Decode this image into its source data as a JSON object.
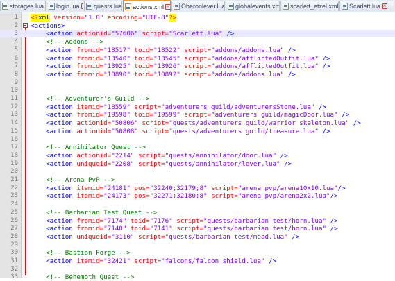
{
  "tabs": [
    {
      "label": "storages.lua",
      "active": false
    },
    {
      "label": "login.lua",
      "active": false
    },
    {
      "label": "quests.lua",
      "active": false
    },
    {
      "label": "actions.xml",
      "active": true
    },
    {
      "label": "Oberonlever.lua",
      "active": false
    },
    {
      "label": "globalevents.xml",
      "active": false
    },
    {
      "label": "scarlett_etzel.xml",
      "active": false
    },
    {
      "label": "Scarlett.lua",
      "active": false
    }
  ],
  "colors": {
    "tag": "#0000ff",
    "attribute": "#ff0000",
    "value": "#8000ff",
    "comment": "#008000",
    "xml_decl_highlight": "#ffff00",
    "current_line": "#e8e8ff",
    "active_tab_accent": "#f39b25"
  },
  "editor": {
    "current_line": 3,
    "lines": [
      {
        "n": "1",
        "tokens": [
          {
            "t": "<?",
            "c": "declq"
          },
          {
            "t": "xml",
            "c": "decl"
          },
          {
            "t": " version=",
            "c": "attr"
          },
          {
            "t": "\"1.0\"",
            "c": "val"
          },
          {
            "t": " encoding=",
            "c": "attr"
          },
          {
            "t": "\"UTF-8\"",
            "c": "val"
          },
          {
            "t": "?>",
            "c": "declq"
          }
        ]
      },
      {
        "n": "2",
        "tokens": [
          {
            "t": "<actions>",
            "c": "tag"
          }
        ]
      },
      {
        "n": "3",
        "tokens": [
          {
            "t": "    "
          },
          {
            "t": "<action",
            "c": "tag"
          },
          {
            "t": " actionid=",
            "c": "attr"
          },
          {
            "t": "\"57606\"",
            "c": "val"
          },
          {
            "t": " script=",
            "c": "attr"
          },
          {
            "t": "\"Scarlett.lua\"",
            "c": "val"
          },
          {
            "t": " />",
            "c": "tag"
          }
        ]
      },
      {
        "n": "4",
        "tokens": [
          {
            "t": "    "
          },
          {
            "t": "<!-- Addons -->",
            "c": "comment"
          }
        ]
      },
      {
        "n": "5",
        "tokens": [
          {
            "t": "    "
          },
          {
            "t": "<action",
            "c": "tag"
          },
          {
            "t": " fromid=",
            "c": "attr"
          },
          {
            "t": "\"18517\"",
            "c": "val"
          },
          {
            "t": " toid=",
            "c": "attr"
          },
          {
            "t": "\"18522\"",
            "c": "val"
          },
          {
            "t": " script=",
            "c": "attr"
          },
          {
            "t": "\"addons/addons.lua\"",
            "c": "val"
          },
          {
            "t": " />",
            "c": "tag"
          }
        ]
      },
      {
        "n": "6",
        "tokens": [
          {
            "t": "    "
          },
          {
            "t": "<action",
            "c": "tag"
          },
          {
            "t": " fromid=",
            "c": "attr"
          },
          {
            "t": "\"13540\"",
            "c": "val"
          },
          {
            "t": " toid=",
            "c": "attr"
          },
          {
            "t": "\"13545\"",
            "c": "val"
          },
          {
            "t": " script=",
            "c": "attr"
          },
          {
            "t": "\"addons/afflictedOutfit.lua\"",
            "c": "val"
          },
          {
            "t": " />",
            "c": "tag"
          }
        ]
      },
      {
        "n": "7",
        "tokens": [
          {
            "t": "    "
          },
          {
            "t": "<action",
            "c": "tag"
          },
          {
            "t": " fromid=",
            "c": "attr"
          },
          {
            "t": "\"13925\"",
            "c": "val"
          },
          {
            "t": " toid=",
            "c": "attr"
          },
          {
            "t": "\"13926\"",
            "c": "val"
          },
          {
            "t": " script=",
            "c": "attr"
          },
          {
            "t": "\"addons/afflictedOutfit.lua\"",
            "c": "val"
          },
          {
            "t": " />",
            "c": "tag"
          }
        ]
      },
      {
        "n": "8",
        "tokens": [
          {
            "t": "    "
          },
          {
            "t": "<action",
            "c": "tag"
          },
          {
            "t": " fromid=",
            "c": "attr"
          },
          {
            "t": "\"10890\"",
            "c": "val"
          },
          {
            "t": " toid=",
            "c": "attr"
          },
          {
            "t": "\"10892\"",
            "c": "val"
          },
          {
            "t": " script=",
            "c": "attr"
          },
          {
            "t": "\"addons/addons.lua\"",
            "c": "val"
          },
          {
            "t": " />",
            "c": "tag"
          }
        ]
      },
      {
        "n": "9",
        "tokens": []
      },
      {
        "n": "10",
        "tokens": []
      },
      {
        "n": "11",
        "tokens": [
          {
            "t": "    "
          },
          {
            "t": "<!-- Adventurer's Guild -->",
            "c": "comment"
          }
        ]
      },
      {
        "n": "12",
        "tokens": [
          {
            "t": "    "
          },
          {
            "t": "<action",
            "c": "tag"
          },
          {
            "t": " itemid=",
            "c": "attr"
          },
          {
            "t": "\"18559\"",
            "c": "val"
          },
          {
            "t": " script=",
            "c": "attr"
          },
          {
            "t": "\"adventurers guild/adventurersStone.lua\"",
            "c": "val"
          },
          {
            "t": " />",
            "c": "tag"
          }
        ]
      },
      {
        "n": "13",
        "tokens": [
          {
            "t": "    "
          },
          {
            "t": "<action",
            "c": "tag"
          },
          {
            "t": " fromid=",
            "c": "attr"
          },
          {
            "t": "\"19598\"",
            "c": "val"
          },
          {
            "t": " toid=",
            "c": "attr"
          },
          {
            "t": "\"19599\"",
            "c": "val"
          },
          {
            "t": " script=",
            "c": "attr"
          },
          {
            "t": "\"adventurers guild/magicDoor.lua\"",
            "c": "val"
          },
          {
            "t": " />",
            "c": "tag"
          }
        ]
      },
      {
        "n": "14",
        "tokens": [
          {
            "t": "    "
          },
          {
            "t": "<action",
            "c": "tag"
          },
          {
            "t": " actionid=",
            "c": "attr"
          },
          {
            "t": "\"50806\"",
            "c": "val"
          },
          {
            "t": " script=",
            "c": "attr"
          },
          {
            "t": "\"quests/adventurers guild/warrior skeleton.lua\"",
            "c": "val"
          },
          {
            "t": " />",
            "c": "tag"
          }
        ]
      },
      {
        "n": "15",
        "tokens": [
          {
            "t": "    "
          },
          {
            "t": "<action",
            "c": "tag"
          },
          {
            "t": " actionid=",
            "c": "attr"
          },
          {
            "t": "\"50808\"",
            "c": "val"
          },
          {
            "t": " script=",
            "c": "attr"
          },
          {
            "t": "\"quests/adventurers guild/treasure.lua\"",
            "c": "val"
          },
          {
            "t": " />",
            "c": "tag"
          }
        ]
      },
      {
        "n": "16",
        "tokens": []
      },
      {
        "n": "17",
        "tokens": [
          {
            "t": "    "
          },
          {
            "t": "<!-- Annihilator Quest -->",
            "c": "comment"
          }
        ]
      },
      {
        "n": "18",
        "tokens": [
          {
            "t": "    "
          },
          {
            "t": "<action",
            "c": "tag"
          },
          {
            "t": " actionid=",
            "c": "attr"
          },
          {
            "t": "\"2214\"",
            "c": "val"
          },
          {
            "t": " script=",
            "c": "attr"
          },
          {
            "t": "\"quests/annihilator/door.lua\"",
            "c": "val"
          },
          {
            "t": " />",
            "c": "tag"
          }
        ]
      },
      {
        "n": "19",
        "tokens": [
          {
            "t": "    "
          },
          {
            "t": "<action",
            "c": "tag"
          },
          {
            "t": " uniqueid=",
            "c": "attr"
          },
          {
            "t": "\"2208\"",
            "c": "val"
          },
          {
            "t": " script=",
            "c": "attr"
          },
          {
            "t": "\"quests/annihilator/lever.lua\"",
            "c": "val"
          },
          {
            "t": " />",
            "c": "tag"
          }
        ]
      },
      {
        "n": "20",
        "tokens": []
      },
      {
        "n": "21",
        "tokens": [
          {
            "t": "    "
          },
          {
            "t": "<!-- Arena PvP -->",
            "c": "comment"
          }
        ]
      },
      {
        "n": "22",
        "tokens": [
          {
            "t": "    "
          },
          {
            "t": "<action",
            "c": "tag"
          },
          {
            "t": " itemid=",
            "c": "attr"
          },
          {
            "t": "\"24181\"",
            "c": "val"
          },
          {
            "t": " pos=",
            "c": "attr"
          },
          {
            "t": "\"32240;32179;8\"",
            "c": "val"
          },
          {
            "t": " script=",
            "c": "attr"
          },
          {
            "t": "\"arena pvp/arena10x10.lua\"",
            "c": "val"
          },
          {
            "t": "/>",
            "c": "tag"
          }
        ]
      },
      {
        "n": "23",
        "tokens": [
          {
            "t": "    "
          },
          {
            "t": "<action",
            "c": "tag"
          },
          {
            "t": " itemid=",
            "c": "attr"
          },
          {
            "t": "\"24173\"",
            "c": "val"
          },
          {
            "t": " pos=",
            "c": "attr"
          },
          {
            "t": "\"32271;32180;8\"",
            "c": "val"
          },
          {
            "t": " script=",
            "c": "attr"
          },
          {
            "t": "\"arena pvp/arena2x2.lua\"",
            "c": "val"
          },
          {
            "t": "/>",
            "c": "tag"
          }
        ]
      },
      {
        "n": "24",
        "tokens": []
      },
      {
        "n": "25",
        "tokens": [
          {
            "t": "    "
          },
          {
            "t": "<!-- Barbarian Test Quest -->",
            "c": "comment"
          }
        ]
      },
      {
        "n": "26",
        "tokens": [
          {
            "t": "    "
          },
          {
            "t": "<action",
            "c": "tag"
          },
          {
            "t": " fromid=",
            "c": "attr"
          },
          {
            "t": "\"7174\"",
            "c": "val"
          },
          {
            "t": " toid=",
            "c": "attr"
          },
          {
            "t": "\"7176\"",
            "c": "val"
          },
          {
            "t": " script=",
            "c": "attr"
          },
          {
            "t": "\"quests/barbarian test/horn.lua\"",
            "c": "val"
          },
          {
            "t": " />",
            "c": "tag"
          }
        ]
      },
      {
        "n": "27",
        "tokens": [
          {
            "t": "    "
          },
          {
            "t": "<action",
            "c": "tag"
          },
          {
            "t": " fromid=",
            "c": "attr"
          },
          {
            "t": "\"7140\"",
            "c": "val"
          },
          {
            "t": " toid=",
            "c": "attr"
          },
          {
            "t": "\"7141\"",
            "c": "val"
          },
          {
            "t": " script=",
            "c": "attr"
          },
          {
            "t": "\"quests/barbarian test/horn.lua\"",
            "c": "val"
          },
          {
            "t": " />",
            "c": "tag"
          }
        ]
      },
      {
        "n": "28",
        "tokens": [
          {
            "t": "    "
          },
          {
            "t": "<action",
            "c": "tag"
          },
          {
            "t": " uniqueid=",
            "c": "attr"
          },
          {
            "t": "\"3110\"",
            "c": "val"
          },
          {
            "t": " script=",
            "c": "attr"
          },
          {
            "t": "\"quests/barbarian test/mead.lua\"",
            "c": "val"
          },
          {
            "t": " />",
            "c": "tag"
          }
        ]
      },
      {
        "n": "29",
        "tokens": []
      },
      {
        "n": "30",
        "tokens": [
          {
            "t": "    "
          },
          {
            "t": "<!-- Bastion Forge -->",
            "c": "comment"
          }
        ]
      },
      {
        "n": "31",
        "tokens": [
          {
            "t": "    "
          },
          {
            "t": "<action",
            "c": "tag"
          },
          {
            "t": " itemid=",
            "c": "attr"
          },
          {
            "t": "\"32421\"",
            "c": "val"
          },
          {
            "t": " script=",
            "c": "attr"
          },
          {
            "t": "\"falcons/falcon_shield.lua\"",
            "c": "val"
          },
          {
            "t": " />",
            "c": "tag"
          }
        ]
      },
      {
        "n": "32",
        "tokens": []
      },
      {
        "n": "33",
        "tokens": [
          {
            "t": "    "
          },
          {
            "t": "<!-- Behemoth Quest -->",
            "c": "comment"
          }
        ]
      }
    ]
  }
}
